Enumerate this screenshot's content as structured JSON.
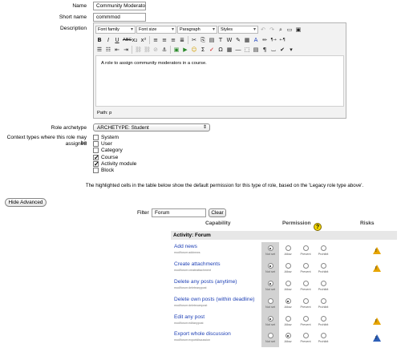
{
  "form": {
    "name_label": "Name",
    "name_value": "Community Moderator",
    "shortname_label": "Short name",
    "shortname_value": "commmod",
    "description_label": "Description"
  },
  "editor": {
    "font_family": "Font family",
    "font_size": "Font size",
    "format": "Paragraph",
    "styles": "Styles",
    "content": "A role to assign community moderators in a course.",
    "path": "Path: p"
  },
  "archetype": {
    "label": "Role archetype",
    "value": "ARCHETYPE: Student"
  },
  "context": {
    "label_line1": "Context types where this role may be",
    "label_line2": "assigned",
    "items": [
      {
        "label": "System",
        "checked": false
      },
      {
        "label": "User",
        "checked": false
      },
      {
        "label": "Category",
        "checked": false
      },
      {
        "label": "Course",
        "checked": true
      },
      {
        "label": "Activity module",
        "checked": true
      },
      {
        "label": "Block",
        "checked": false
      }
    ],
    "check_mark": "✓"
  },
  "info_text": "The highlighted cells in the table below show the default permission for this type of role, based on the 'Legacy role type above'.",
  "hide_advanced": "Hide Advanced",
  "filter": {
    "label": "Filter",
    "value": "Forum",
    "clear": "Clear"
  },
  "table": {
    "capability_header": "Capability",
    "permission_header": "Permission",
    "help_glyph": "?",
    "risks_header": "Risks",
    "section": "Activity: Forum",
    "perm_labels": [
      "Not set",
      "Allow",
      "Prevent",
      "Prohibit"
    ],
    "risk_glyph": "!",
    "rows": [
      {
        "name": "Add news",
        "id": "mod/forum:addnews",
        "selected": 0,
        "risk": "orange"
      },
      {
        "name": "Create attachments",
        "id": "mod/forum:createattachment",
        "selected": 0,
        "risk": "orange"
      },
      {
        "name": "Delete any posts (anytime)",
        "id": "mod/forum:deleteanypost",
        "selected": 0,
        "risk": ""
      },
      {
        "name": "Delete own posts (within deadline)",
        "id": "mod/forum:deleteownpost",
        "selected": 1,
        "risk": ""
      },
      {
        "name": "Edit any post",
        "id": "mod/forum:editanypost",
        "selected": 0,
        "risk": "orange"
      },
      {
        "name": "Export whole discussion",
        "id": "mod/forum:exportdiscussion",
        "selected": 1,
        "risk": "blue"
      }
    ]
  }
}
